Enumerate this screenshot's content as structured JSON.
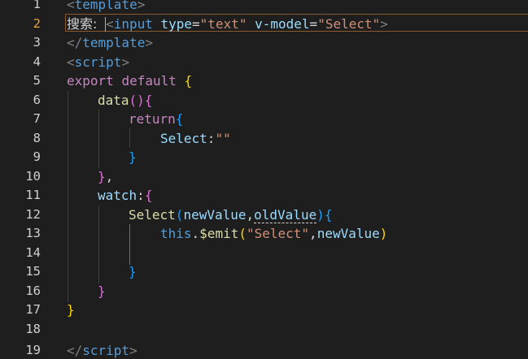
{
  "editor": {
    "line_numbers": [
      "1",
      "2",
      "3",
      "4",
      "5",
      "6",
      "7",
      "8",
      "9",
      "10",
      "11",
      "12",
      "13",
      "14",
      "15",
      "16",
      "17",
      "18",
      "19"
    ],
    "active_line": "2",
    "tokens": {
      "l1_open": "<",
      "l1_tag": "template",
      "l1_close": ">",
      "l2_label": "搜索:",
      "l2_open": "<",
      "l2_tag": "input",
      "l2_attr1": "type",
      "l2_eq1": "=",
      "l2_val1": "\"text\"",
      "l2_attr2": "v-model",
      "l2_eq2": "=",
      "l2_val2": "\"Select\"",
      "l2_close": ">",
      "l3_open": "</",
      "l3_tag": "template",
      "l3_close": ">",
      "l4_open": "<",
      "l4_tag": "script",
      "l4_close": ">",
      "l5_export": "export",
      "l5_default": "default",
      "l5_brace": "{",
      "l6_fn": "data",
      "l6_paren": "()",
      "l6_brace": "{",
      "l7_return": "return",
      "l7_brace": "{",
      "l8_prop": "Select",
      "l8_colon": ":",
      "l8_str": "\"\"",
      "l9_brace": "}",
      "l10_brace": "}",
      "l10_comma": ",",
      "l11_prop": "watch",
      "l11_colon": ":",
      "l11_brace": "{",
      "l12_fn": "Select",
      "l12_paren_open": "(",
      "l12_param1": "newValue",
      "l12_comma": ",",
      "l12_param2": "oldValue",
      "l12_paren_close": ")",
      "l12_brace": "{",
      "l13_this": "this",
      "l13_dot": ".",
      "l13_emit": "$emit",
      "l13_paren_open": "(",
      "l13_str": "\"Select\"",
      "l13_comma": ",",
      "l13_arg": "newValue",
      "l13_paren_close": ")",
      "l15_brace": "}",
      "l16_brace": "}",
      "l17_brace": "}",
      "l19_open": "</",
      "l19_tag": "script",
      "l19_close": ">"
    }
  },
  "colors": {
    "background": "#1e1e1e",
    "tag_bracket": "#808080",
    "tag_name": "#569cd6",
    "attribute": "#9cdcfe",
    "string": "#ce9178",
    "keyword": "#c586c0",
    "function": "#dcdcaa",
    "active_line_number": "#e6a23c"
  }
}
